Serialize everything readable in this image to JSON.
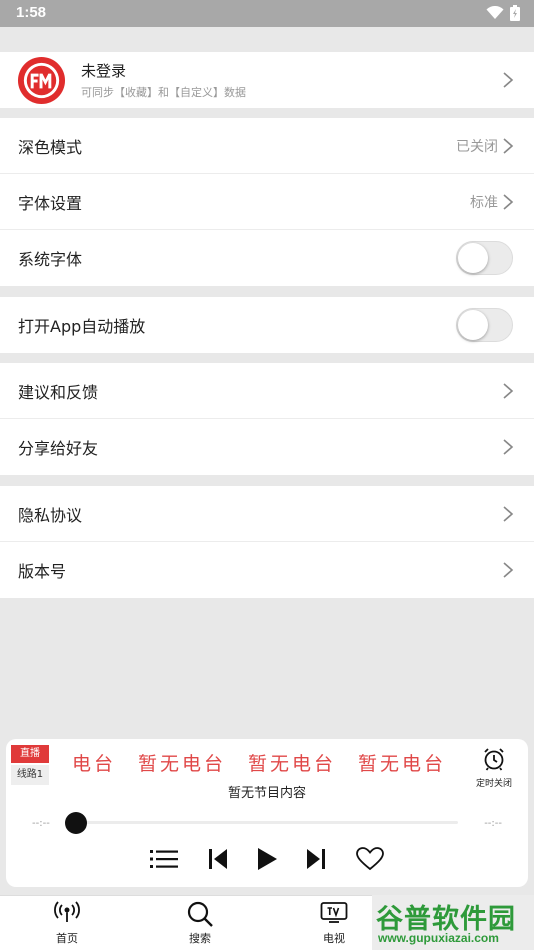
{
  "status_bar": {
    "time": "1:58"
  },
  "profile": {
    "title": "未登录",
    "subtitle": "可同步【收藏】和【自定义】数据"
  },
  "settings": {
    "dark_mode": {
      "label": "深色模式",
      "value": "已关闭"
    },
    "font_settings": {
      "label": "字体设置",
      "value": "标准"
    },
    "system_font": {
      "label": "系统字体",
      "enabled": false
    },
    "auto_play": {
      "label": "打开App自动播放",
      "enabled": false
    },
    "feedback": {
      "label": "建议和反馈"
    },
    "share": {
      "label": "分享给好友"
    },
    "privacy": {
      "label": "隐私协议"
    },
    "version": {
      "label": "版本号"
    }
  },
  "player": {
    "live_badge": "直播",
    "line_badge": "线路1",
    "marquee": [
      "电台",
      "暂无电台",
      "暂无电台",
      "暂无电台",
      "暂"
    ],
    "no_program": "暂无节目内容",
    "timer_label": "定时关闭",
    "time_start": "--:--",
    "time_end": "--:--",
    "progress": 0
  },
  "tabs": [
    {
      "label": "首页",
      "icon": "radio-broadcast-icon"
    },
    {
      "label": "搜索",
      "icon": "search-icon"
    },
    {
      "label": "电视",
      "icon": "tv-icon"
    }
  ],
  "watermark": {
    "text": "谷普软件园",
    "url": "www.gupuxiazai.com"
  },
  "colors": {
    "accent_red": "#e03a3a",
    "marquee_red": "#e04848",
    "watermark_green": "#2e9a3a"
  }
}
